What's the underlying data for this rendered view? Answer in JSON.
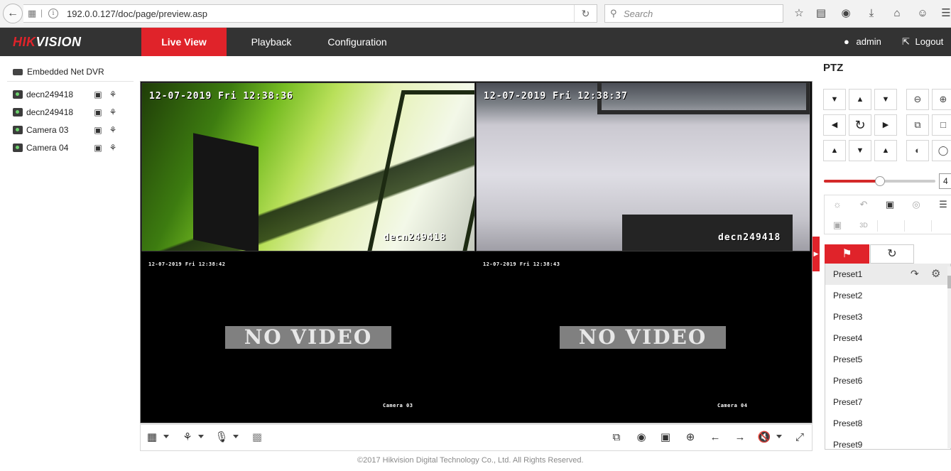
{
  "browser": {
    "url": "192.0.0.127/doc/page/preview.asp",
    "search_placeholder": "Search",
    "icons": [
      "back-icon",
      "grid-icon",
      "info-icon",
      "reload-icon",
      "search-icon",
      "star-icon",
      "reading-list-icon",
      "pocket-icon",
      "download-icon",
      "home-icon",
      "chat-icon",
      "menu-icon"
    ]
  },
  "header": {
    "logo_red": "HIK",
    "logo_white": "VISION",
    "tabs": [
      {
        "label": "Live View",
        "active": true
      },
      {
        "label": "Playback",
        "active": false
      },
      {
        "label": "Configuration",
        "active": false
      }
    ],
    "user": "admin",
    "logout": "Logout",
    "accent_color": "#e0232a",
    "bar_color": "#333333"
  },
  "tree": {
    "root": "Embedded Net DVR",
    "cameras": [
      {
        "label": "decn249418"
      },
      {
        "label": "decn249418"
      },
      {
        "label": "Camera 03"
      },
      {
        "label": "Camera 04"
      }
    ]
  },
  "video": {
    "panes": [
      {
        "timestamp": "12-07-2019 Fri 12:38:36",
        "channel_name": "decn249418",
        "no_video": false
      },
      {
        "timestamp": "12-07-2019 Fri 12:38:37",
        "channel_name": "decn249418",
        "no_video": false
      },
      {
        "timestamp": "12-07-2019 Fri 12:38:42",
        "channel_name": "Camera 03",
        "no_video": true
      },
      {
        "timestamp": "12-07-2019 Fri 12:38:43",
        "channel_name": "Camera 04",
        "no_video": true
      }
    ],
    "no_video_text": "NO VIDEO"
  },
  "footer": "©2017 Hikvision Digital Technology Co., Ltd. All Rights Reserved.",
  "ptz": {
    "title": "PTZ",
    "speed_value": "4",
    "speed_fraction": 0.5,
    "tabs": [
      "preset-flag-icon",
      "patrol-icon"
    ],
    "presets": [
      "Preset1",
      "Preset2",
      "Preset3",
      "Preset4",
      "Preset5",
      "Preset6",
      "Preset7",
      "Preset8",
      "Preset9"
    ]
  }
}
